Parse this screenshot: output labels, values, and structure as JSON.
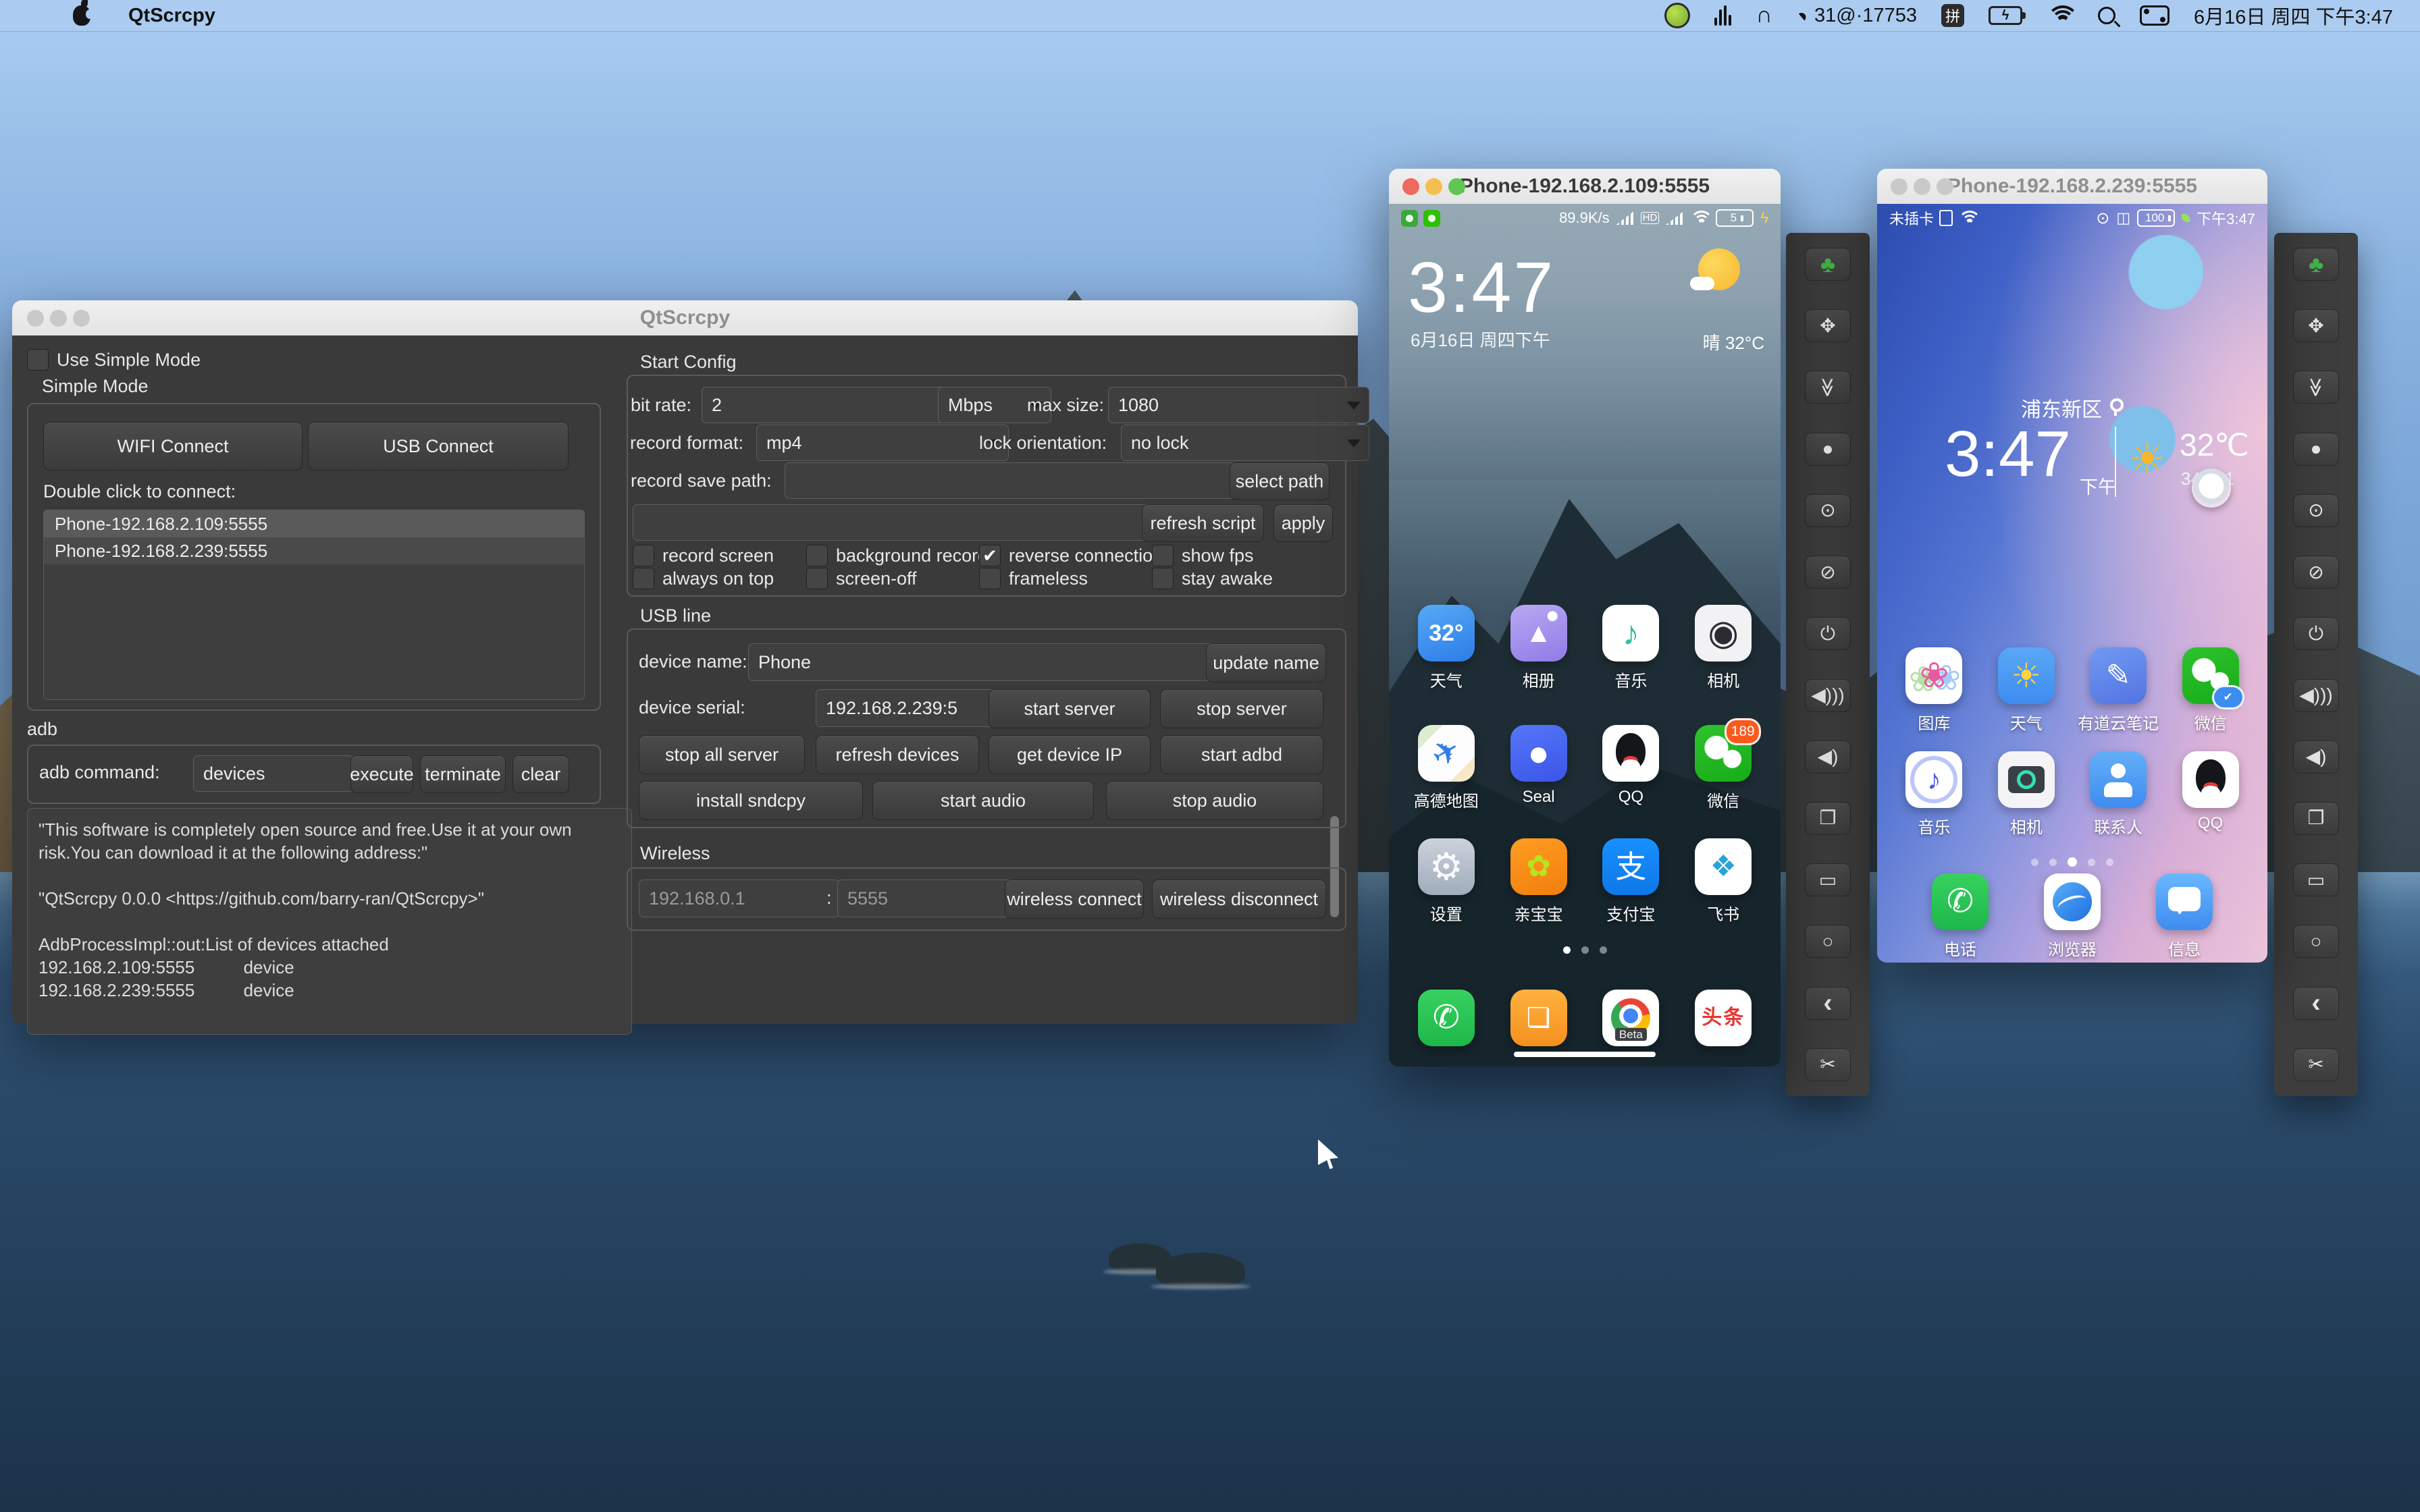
{
  "menu_bar": {
    "app_name": "QtScrcpy",
    "stat_text": "31@·17753",
    "ime": "拼",
    "clock": "6月16日 周四 下午3:47",
    "battery_bolt": "ϟ"
  },
  "main_window": {
    "title": "QtScrcpy",
    "use_simple_mode": "Use Simple Mode",
    "simple_mode": "Simple Mode",
    "wifi_connect": "WIFI Connect",
    "usb_connect": "USB Connect",
    "double_click_label": "Double click to connect:",
    "devices": [
      "Phone-192.168.2.109:5555",
      "Phone-192.168.2.239:5555"
    ],
    "adb_group": "adb",
    "adb_command_label": "adb command:",
    "adb_command_value": "devices",
    "btn_execute": "execute",
    "btn_terminate": "terminate",
    "btn_clear": "clear",
    "log_text": "\"This software is completely open source and free.Use it at your own risk.You can download it at the following address:\"\n\n\"QtScrcpy 0.0.0 <https://github.com/barry-ran/QtScrcpy>\"\n\nAdbProcessImpl::out:List of devices attached\n192.168.2.109:5555          device\n192.168.2.239:5555          device"
  },
  "config": {
    "section": "Start Config",
    "bit_rate_label": "bit rate:",
    "bit_rate": "2",
    "bit_rate_unit": "Mbps",
    "max_size_label": "max size:",
    "max_size": "1080",
    "record_format_label": "record format:",
    "record_format": "mp4",
    "lock_orientation_label": "lock orientation:",
    "lock_orientation": "no lock",
    "record_save_path_label": "record save path:",
    "record_save_path": "",
    "btn_select_path": "select path",
    "script_value": "",
    "btn_refresh_script": "refresh script",
    "btn_apply": "apply",
    "checks": [
      {
        "label": "record screen",
        "mark": ""
      },
      {
        "label": "background record",
        "mark": ""
      },
      {
        "label": "reverse connection",
        "mark": "✔"
      },
      {
        "label": "show fps",
        "mark": ""
      },
      {
        "label": "always on top",
        "mark": ""
      },
      {
        "label": "screen-off",
        "mark": ""
      },
      {
        "label": "frameless",
        "mark": ""
      },
      {
        "label": "stay awake",
        "mark": ""
      }
    ]
  },
  "usb": {
    "section": "USB line",
    "device_name_label": "device name:",
    "device_name": "Phone",
    "btn_update_name": "update name",
    "device_serial_label": "device serial:",
    "device_serial": "192.168.2.239:5",
    "btn_start_server": "start server",
    "btn_stop_server": "stop server",
    "btn_stop_all": "stop all server",
    "btn_refresh_devices": "refresh devices",
    "btn_get_ip": "get device IP",
    "btn_start_adbd": "start adbd",
    "btn_install_sndcpy": "install sndcpy",
    "btn_start_audio": "start audio",
    "btn_stop_audio": "stop audio"
  },
  "wireless": {
    "section": "Wireless",
    "ip_placeholder": "192.168.0.1",
    "colon": ":",
    "port_placeholder": "5555",
    "btn_connect": "wireless connect",
    "btn_disconnect": "wireless disconnect"
  },
  "phone1": {
    "title": "Phone-192.168.2.109:5555",
    "net_speed": "89.9K/s",
    "hd": "HD",
    "battery": "5",
    "bolt": "ϟ",
    "clock": "3:47",
    "date": "6月16日 周四下午",
    "weather": "晴  32°C",
    "apps": [
      {
        "label": "天气",
        "glyph": "32°"
      },
      {
        "label": "相册",
        "glyph": "▲"
      },
      {
        "label": "音乐",
        "glyph": "♪"
      },
      {
        "label": "相机",
        "glyph": "◉"
      },
      {
        "label": "高德地图",
        "glyph": "✈"
      },
      {
        "label": "Seal",
        "glyph": "●"
      },
      {
        "label": "QQ",
        "glyph": ""
      },
      {
        "label": "微信",
        "glyph": "",
        "badge": "189"
      },
      {
        "label": "设置",
        "glyph": "⚙"
      },
      {
        "label": "亲宝宝",
        "glyph": "✿"
      },
      {
        "label": "支付宝",
        "glyph": "支"
      },
      {
        "label": "飞书",
        "glyph": "❖"
      }
    ],
    "dock": [
      {
        "glyph": "✆"
      },
      {
        "glyph": "❏"
      },
      {
        "glyph": "Beta"
      },
      {
        "glyph": "头条"
      }
    ]
  },
  "phone2": {
    "title": "Phone-192.168.2.239:5555",
    "no_sim": "未插卡",
    "eye": "⊙",
    "vibrate": "◫",
    "battery": "100",
    "clock_small": "下午3:47",
    "location": "浦东新区",
    "clock": "3:47",
    "ampm": "下午",
    "sun": "☀",
    "temp": "32℃",
    "hilo": "34 / 21",
    "apps": [
      {
        "label": "图库",
        "glyph": "❀"
      },
      {
        "label": "天气",
        "glyph": "☀"
      },
      {
        "label": "有道云笔记",
        "glyph": "✎"
      },
      {
        "label": "微信",
        "glyph": "",
        "badge": "✔"
      },
      {
        "label": "音乐",
        "glyph": "♪"
      },
      {
        "label": "相机",
        "glyph": ""
      },
      {
        "label": "联系人",
        "glyph": ""
      },
      {
        "label": "QQ",
        "glyph": ""
      }
    ],
    "dock": [
      {
        "label": "电话",
        "glyph": "✆"
      },
      {
        "label": "浏览器",
        "glyph": ""
      },
      {
        "label": "信息",
        "glyph": ""
      }
    ]
  },
  "toolbar": {
    "buttons": [
      {
        "glyph": "♣"
      },
      {
        "glyph": "✥"
      },
      {
        "glyph": "≫"
      },
      {
        "glyph": "●"
      },
      {
        "glyph": "⊙"
      },
      {
        "glyph": "⊘"
      },
      {
        "glyph": "⏻"
      },
      {
        "glyph": "◀)))"
      },
      {
        "glyph": "◀)"
      },
      {
        "glyph": "❐"
      },
      {
        "glyph": "▭"
      },
      {
        "glyph": "○"
      },
      {
        "glyph": "‹"
      },
      {
        "glyph": "✂"
      }
    ]
  }
}
